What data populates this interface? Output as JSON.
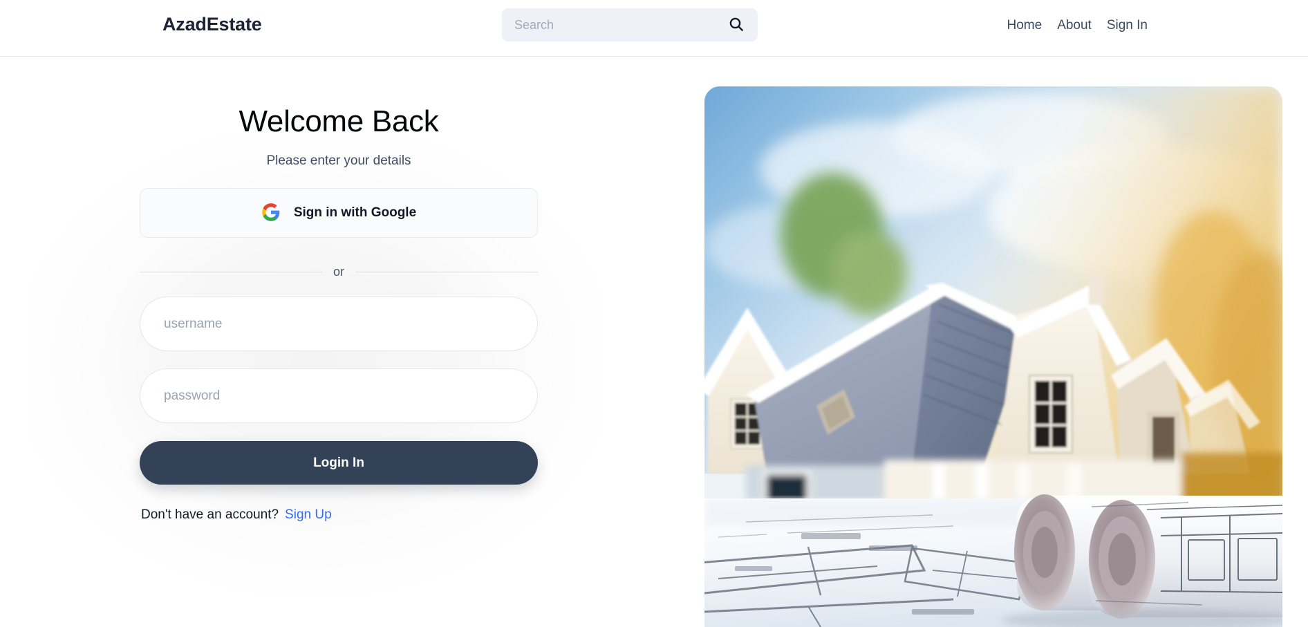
{
  "header": {
    "brand": "AzadEstate",
    "search": {
      "placeholder": "Search",
      "value": "",
      "icon": "search-icon"
    },
    "nav": [
      {
        "label": "Home"
      },
      {
        "label": "About"
      },
      {
        "label": "Sign In"
      }
    ]
  },
  "login": {
    "title": "Welcome Back",
    "subtitle": "Please enter your details",
    "google_button": {
      "label": "Sign in with Google",
      "icon": "google-g-icon"
    },
    "divider_label": "or",
    "username": {
      "placeholder": "username",
      "value": ""
    },
    "password": {
      "placeholder": "password",
      "value": ""
    },
    "submit_label": "Login In",
    "signup_prompt": "Don't have an account?",
    "signup_link": "Sign Up"
  },
  "hero": {
    "alt": "suburban house with gabled roofs above architectural blueprints and rolled plans"
  },
  "colors": {
    "brand_text": "#1b2335",
    "primary_button": "#334257",
    "link_blue": "#2f6df6",
    "search_bg": "#eef1f6",
    "border": "#e3e6ea"
  }
}
